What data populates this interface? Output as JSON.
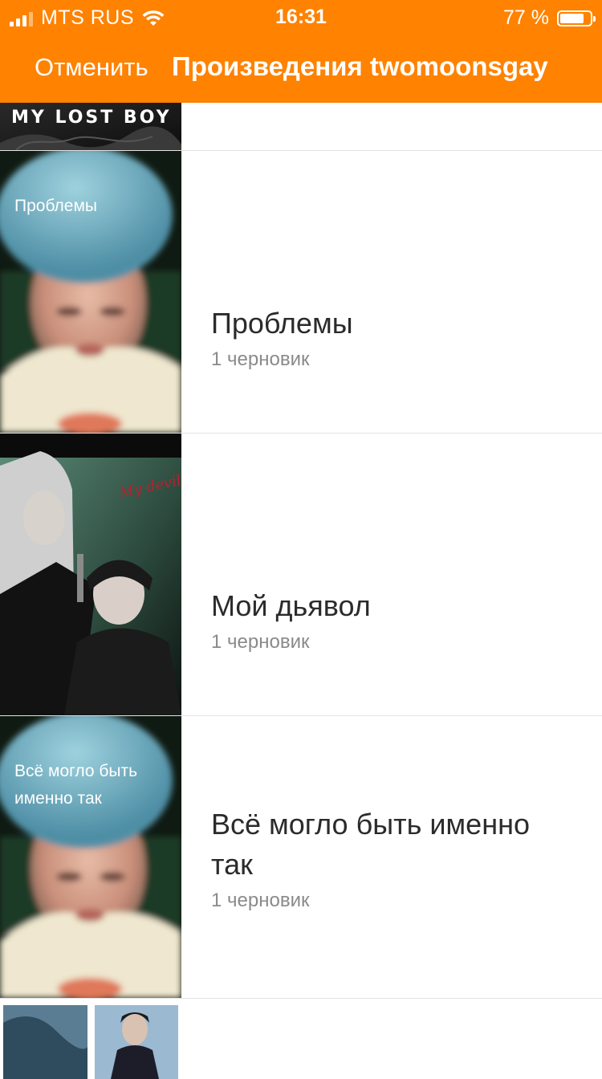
{
  "status_bar": {
    "carrier": "MTS RUS",
    "time": "16:31",
    "battery_percent": "77 %"
  },
  "nav": {
    "cancel_label": "Отменить",
    "title": "Произведения twomoonsgay"
  },
  "works": [
    {
      "cover_text": "MY LOST BOY"
    },
    {
      "cover_text": "Проблемы",
      "title": "Проблемы",
      "subtitle": "1 черновик"
    },
    {
      "cover_text": "My devil",
      "title": "Мой дьявол",
      "subtitle": "1 черновик"
    },
    {
      "cover_text": "Всё могло быть именно так",
      "title": "Всё могло быть именно так",
      "subtitle": "1 черновик"
    }
  ],
  "colors": {
    "accent": "#ff8200",
    "title_text": "#2b2b2b",
    "subtitle_text": "#8a8a8a",
    "divider": "#e3e3e3"
  }
}
